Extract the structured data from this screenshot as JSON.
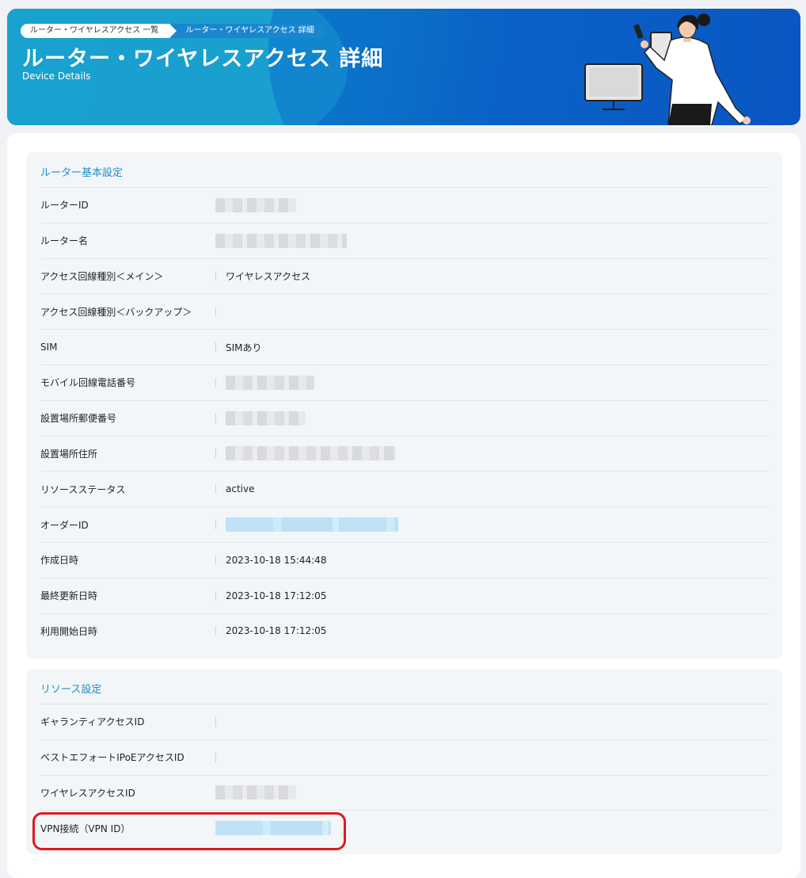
{
  "header": {
    "breadcrumbs": [
      "ルーター・ワイヤレスアクセス 一覧",
      "ルーター・ワイヤレスアクセス 詳細"
    ],
    "title": "ルーター・ワイヤレスアクセス 詳細",
    "subtitle": "Device Details"
  },
  "sections": [
    {
      "title": "ルーター基本設定",
      "rows": [
        {
          "label": "ルーターID",
          "value": "",
          "masked": "gray"
        },
        {
          "label": "ルーター名",
          "value": "",
          "masked": "gray"
        },
        {
          "label": "アクセス回線種別＜メイン＞",
          "value": "ワイヤレスアクセス"
        },
        {
          "label": "アクセス回線種別＜バックアップ＞",
          "value": ""
        },
        {
          "label": "SIM",
          "value": "SIMあり"
        },
        {
          "label": "モバイル回線電話番号",
          "value": "",
          "masked": "gray"
        },
        {
          "label": "設置場所郵便番号",
          "value": "",
          "masked": "gray"
        },
        {
          "label": "設置場所住所",
          "value": "",
          "masked": "gray"
        },
        {
          "label": "リソースステータス",
          "value": "active"
        },
        {
          "label": "オーダーID",
          "value": "",
          "masked": "blue"
        },
        {
          "label": "作成日時",
          "value": "2023-10-18 15:44:48"
        },
        {
          "label": "最終更新日時",
          "value": "2023-10-18 17:12:05"
        },
        {
          "label": "利用開始日時",
          "value": "2023-10-18 17:12:05"
        }
      ]
    },
    {
      "title": "リソース設定",
      "rows": [
        {
          "label": "ギャランティアクセスID",
          "value": ""
        },
        {
          "label": "ベストエフォートIPoEアクセスID",
          "value": ""
        },
        {
          "label": "ワイヤレスアクセスID",
          "value": "",
          "masked": "gray"
        },
        {
          "label": "VPN接続（VPN ID）",
          "value": "",
          "masked": "blue"
        }
      ]
    }
  ],
  "colors": {
    "accent": "#1b8fc4",
    "highlight": "#e0191a",
    "header_blue": "#0a63c6"
  }
}
